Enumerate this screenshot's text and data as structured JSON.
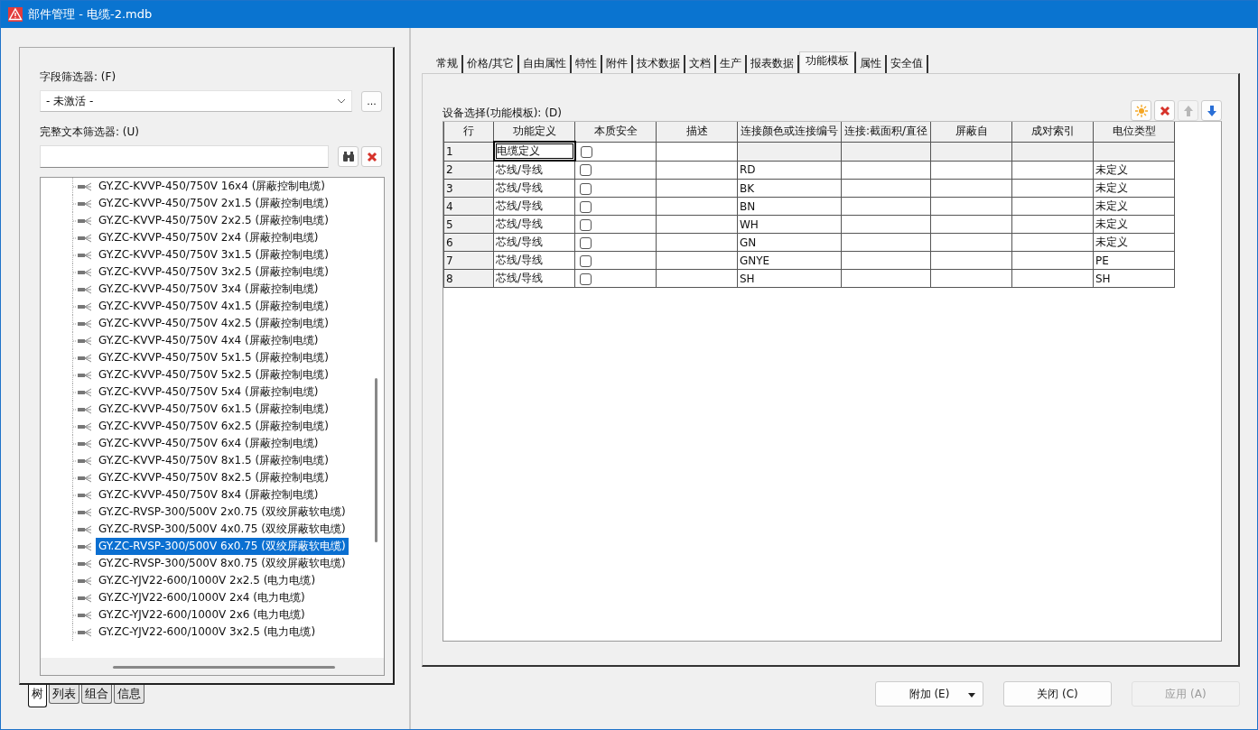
{
  "window": {
    "title": "部件管理 - 电缆-2.mdb"
  },
  "left": {
    "field_filter": {
      "label": "字段筛选器: (F)",
      "value": "- 未激活 -",
      "more": "..."
    },
    "fulltext_filter": {
      "label": "完整文本筛选器: (U)"
    },
    "tree": [
      {
        "label": "GY.ZC-KVVP-450/750V 16x4 (屏蔽控制电缆)",
        "selected": false
      },
      {
        "label": "GY.ZC-KVVP-450/750V 2x1.5 (屏蔽控制电缆)",
        "selected": false
      },
      {
        "label": "GY.ZC-KVVP-450/750V 2x2.5 (屏蔽控制电缆)",
        "selected": false
      },
      {
        "label": "GY.ZC-KVVP-450/750V 2x4 (屏蔽控制电缆)",
        "selected": false
      },
      {
        "label": "GY.ZC-KVVP-450/750V 3x1.5 (屏蔽控制电缆)",
        "selected": false
      },
      {
        "label": "GY.ZC-KVVP-450/750V 3x2.5 (屏蔽控制电缆)",
        "selected": false
      },
      {
        "label": "GY.ZC-KVVP-450/750V 3x4 (屏蔽控制电缆)",
        "selected": false
      },
      {
        "label": "GY.ZC-KVVP-450/750V 4x1.5 (屏蔽控制电缆)",
        "selected": false
      },
      {
        "label": "GY.ZC-KVVP-450/750V 4x2.5 (屏蔽控制电缆)",
        "selected": false
      },
      {
        "label": "GY.ZC-KVVP-450/750V 4x4 (屏蔽控制电缆)",
        "selected": false
      },
      {
        "label": "GY.ZC-KVVP-450/750V 5x1.5 (屏蔽控制电缆)",
        "selected": false
      },
      {
        "label": "GY.ZC-KVVP-450/750V 5x2.5 (屏蔽控制电缆)",
        "selected": false
      },
      {
        "label": "GY.ZC-KVVP-450/750V 5x4 (屏蔽控制电缆)",
        "selected": false
      },
      {
        "label": "GY.ZC-KVVP-450/750V 6x1.5 (屏蔽控制电缆)",
        "selected": false
      },
      {
        "label": "GY.ZC-KVVP-450/750V 6x2.5 (屏蔽控制电缆)",
        "selected": false
      },
      {
        "label": "GY.ZC-KVVP-450/750V 6x4 (屏蔽控制电缆)",
        "selected": false
      },
      {
        "label": "GY.ZC-KVVP-450/750V 8x1.5 (屏蔽控制电缆)",
        "selected": false
      },
      {
        "label": "GY.ZC-KVVP-450/750V 8x2.5 (屏蔽控制电缆)",
        "selected": false
      },
      {
        "label": "GY.ZC-KVVP-450/750V 8x4 (屏蔽控制电缆)",
        "selected": false
      },
      {
        "label": "GY.ZC-RVSP-300/500V 2x0.75 (双绞屏蔽软电缆)",
        "selected": false
      },
      {
        "label": "GY.ZC-RVSP-300/500V 4x0.75 (双绞屏蔽软电缆)",
        "selected": false
      },
      {
        "label": "GY.ZC-RVSP-300/500V 6x0.75 (双绞屏蔽软电缆)",
        "selected": true
      },
      {
        "label": "GY.ZC-RVSP-300/500V 8x0.75 (双绞屏蔽软电缆)",
        "selected": false
      },
      {
        "label": "GY.ZC-YJV22-600/1000V 2x2.5 (电力电缆)",
        "selected": false
      },
      {
        "label": "GY.ZC-YJV22-600/1000V 2x4 (电力电缆)",
        "selected": false
      },
      {
        "label": "GY.ZC-YJV22-600/1000V 2x6 (电力电缆)",
        "selected": false
      },
      {
        "label": "GY.ZC-YJV22-600/1000V 3x2.5 (电力电缆)",
        "selected": false
      }
    ],
    "bottom_tabs": [
      {
        "label": "树",
        "selected": true
      },
      {
        "label": "列表",
        "selected": false
      },
      {
        "label": "组合",
        "selected": false
      },
      {
        "label": "信息",
        "selected": false
      }
    ]
  },
  "right": {
    "tabs": [
      {
        "label": "常规",
        "selected": false
      },
      {
        "label": "价格/其它",
        "selected": false
      },
      {
        "label": "自由属性",
        "selected": false
      },
      {
        "label": "特性",
        "selected": false
      },
      {
        "label": "附件",
        "selected": false
      },
      {
        "label": "技术数据",
        "selected": false
      },
      {
        "label": "文档",
        "selected": false
      },
      {
        "label": "生产",
        "selected": false
      },
      {
        "label": "报表数据",
        "selected": false
      },
      {
        "label": "功能模板",
        "selected": true
      },
      {
        "label": "属性",
        "selected": false
      },
      {
        "label": "安全值",
        "selected": false
      }
    ],
    "section_label": "设备选择(功能模板): (D)",
    "toolbar": [
      {
        "kind": "new",
        "disabled": false
      },
      {
        "kind": "delete",
        "disabled": false
      },
      {
        "kind": "up",
        "disabled": true
      },
      {
        "kind": "down",
        "disabled": false
      }
    ],
    "table": {
      "columns": [
        "行",
        "功能定义",
        "本质安全",
        "描述",
        "连接颜色或连接编号",
        "连接:截面积/直径",
        "屏蔽自",
        "成对索引",
        "电位类型"
      ],
      "rows": [
        {
          "kind": "cable",
          "focused": true,
          "row": "1",
          "function": "电缆定义",
          "checked": false,
          "color_or_number": "",
          "potential": ""
        },
        {
          "kind": "core",
          "focused": false,
          "row": "2",
          "function": "芯线/导线",
          "checked": false,
          "color_or_number": "RD",
          "potential": "未定义"
        },
        {
          "kind": "core",
          "focused": false,
          "row": "3",
          "function": "芯线/导线",
          "checked": false,
          "color_or_number": "BK",
          "potential": "未定义"
        },
        {
          "kind": "core",
          "focused": false,
          "row": "4",
          "function": "芯线/导线",
          "checked": false,
          "color_or_number": "BN",
          "potential": "未定义"
        },
        {
          "kind": "core",
          "focused": false,
          "row": "5",
          "function": "芯线/导线",
          "checked": false,
          "color_or_number": "WH",
          "potential": "未定义"
        },
        {
          "kind": "core",
          "focused": false,
          "row": "6",
          "function": "芯线/导线",
          "checked": false,
          "color_or_number": "GN",
          "potential": "未定义"
        },
        {
          "kind": "core",
          "focused": false,
          "row": "7",
          "function": "芯线/导线",
          "checked": false,
          "color_or_number": "GNYE",
          "potential": "PE"
        },
        {
          "kind": "core",
          "focused": false,
          "row": "8",
          "function": "芯线/导线",
          "checked": false,
          "color_or_number": "SH",
          "potential": "SH"
        }
      ]
    }
  },
  "buttons": [
    {
      "label": "附加 (E)",
      "kind": "dropdown",
      "disabled": false
    },
    {
      "label": "关闭 (C)",
      "kind": "plain",
      "disabled": false
    },
    {
      "label": "应用 (A)",
      "kind": "plain",
      "disabled": true
    }
  ]
}
